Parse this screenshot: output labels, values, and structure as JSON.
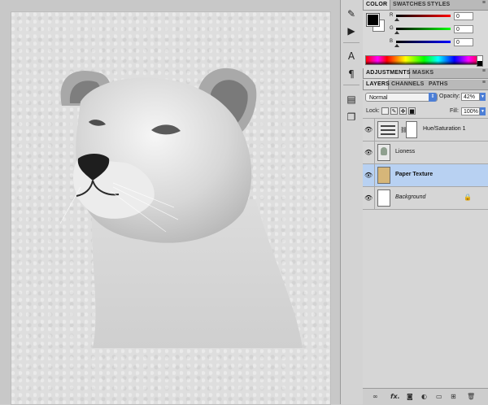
{
  "color_panel": {
    "tabs": [
      "COLOR",
      "SWATCHES",
      "STYLES"
    ],
    "sliders": [
      {
        "label": "R",
        "value": "0"
      },
      {
        "label": "G",
        "value": "0"
      },
      {
        "label": "B",
        "value": "0"
      }
    ],
    "foreground": "#000000",
    "background": "#ffffff"
  },
  "adjustments_panel": {
    "tabs": [
      "ADJUSTMENTS",
      "MASKS"
    ]
  },
  "layers_panel": {
    "tabs": [
      "LAYERS",
      "CHANNELS",
      "PATHS"
    ],
    "blend_mode": "Normal",
    "opacity_label": "Opacity:",
    "opacity_value": "42%",
    "lock_label": "Lock:",
    "fill_label": "Fill:",
    "fill_value": "100%",
    "layers": [
      {
        "name": "Hue/Saturation 1",
        "type": "adjustment",
        "selected": false
      },
      {
        "name": "Lioness",
        "type": "image",
        "selected": false
      },
      {
        "name": "Paper Texture",
        "type": "image",
        "selected": true
      },
      {
        "name": "Background",
        "type": "background",
        "selected": false,
        "locked": true
      }
    ]
  },
  "tools": [
    "history-brush-icon",
    "actions-icon",
    "character-icon",
    "paragraph-icon",
    "notes-icon",
    "clone-source-icon"
  ],
  "footer_icons": [
    "link-icon",
    "fx-icon",
    "mask-icon",
    "adjustment-icon",
    "group-icon",
    "new-layer-icon",
    "trash-icon"
  ]
}
